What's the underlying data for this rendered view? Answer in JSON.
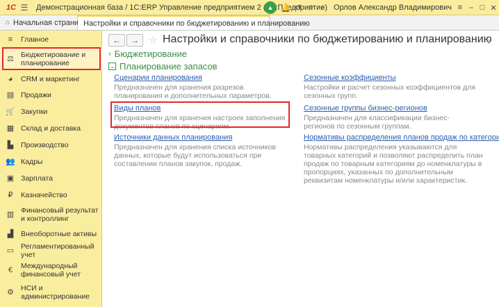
{
  "titlebar": {
    "logo": "1C",
    "title": "Демонстрационная база / 1С:ERP Управление предприятием 2  (1С:Предприятие)",
    "user": "Орлов Александр Владимирович"
  },
  "tabs": [
    {
      "label": "Начальная страница"
    },
    {
      "label": "Настройки и справочники по бюджетированию и планированию"
    }
  ],
  "sidebar": {
    "items": [
      {
        "label": "Главное",
        "icon": "menu-icon"
      },
      {
        "label": "Бюджетирование и планирование",
        "icon": "budget-icon"
      },
      {
        "label": "CRM и маркетинг",
        "icon": "crm-icon"
      },
      {
        "label": "Продажи",
        "icon": "sales-icon"
      },
      {
        "label": "Закупки",
        "icon": "cart-icon"
      },
      {
        "label": "Склад и доставка",
        "icon": "warehouse-icon"
      },
      {
        "label": "Производство",
        "icon": "factory-icon"
      },
      {
        "label": "Кадры",
        "icon": "people-icon"
      },
      {
        "label": "Зарплата",
        "icon": "salary-icon"
      },
      {
        "label": "Казначейство",
        "icon": "treasury-icon"
      },
      {
        "label": "Финансовый результат и контроллинг",
        "icon": "finance-icon"
      },
      {
        "label": "Внеоборотные активы",
        "icon": "assets-icon"
      },
      {
        "label": "Регламентированный учет",
        "icon": "accounting-icon"
      },
      {
        "label": "Международный финансовый учет",
        "icon": "intl-icon"
      },
      {
        "label": "НСИ и администрирование",
        "icon": "settings-icon"
      }
    ]
  },
  "main": {
    "title": "Настройки и справочники по бюджетированию и планированию",
    "groups": [
      {
        "label": "Бюджетирование",
        "collapsed": true
      },
      {
        "label": "Планирование запасов",
        "collapsed": false
      }
    ],
    "items_left": [
      {
        "link": "Сценарии планирования",
        "desc": "Предназначен для хранения разрезов планирования и дополнительных параметров."
      },
      {
        "link": "Виды планов",
        "desc": "Предназначен для хранения настроек заполнения документов планов по сценариям."
      },
      {
        "link": "Источники данных планирования",
        "desc": "Предназначен для хранения списка источников данных, которые будут использоваться при составлении планов закупок, продаж."
      }
    ],
    "items_right": [
      {
        "link": "Сезонные коэффициенты",
        "desc": "Настройки и расчет сезонных коэффициентов для сезонных групп."
      },
      {
        "link": "Сезонные группы бизнес-регионов",
        "desc": "Предназначен для классификации бизнес-регионов по сезонным группам."
      },
      {
        "link": "Нормативы распределения планов продаж по категориям",
        "desc": "Нормативы распределения указываются для товарных категорий и позволяют распределить план продаж по товарным категориям до номенклатуры в пропорциях, указанных по дополнительным реквизитам номенклатуры и/или характеристик."
      }
    ]
  },
  "colors": {
    "accent": "#fbed9e",
    "link": "#2a5db0",
    "group": "#3c8d44",
    "highlight": "#e3262b"
  }
}
